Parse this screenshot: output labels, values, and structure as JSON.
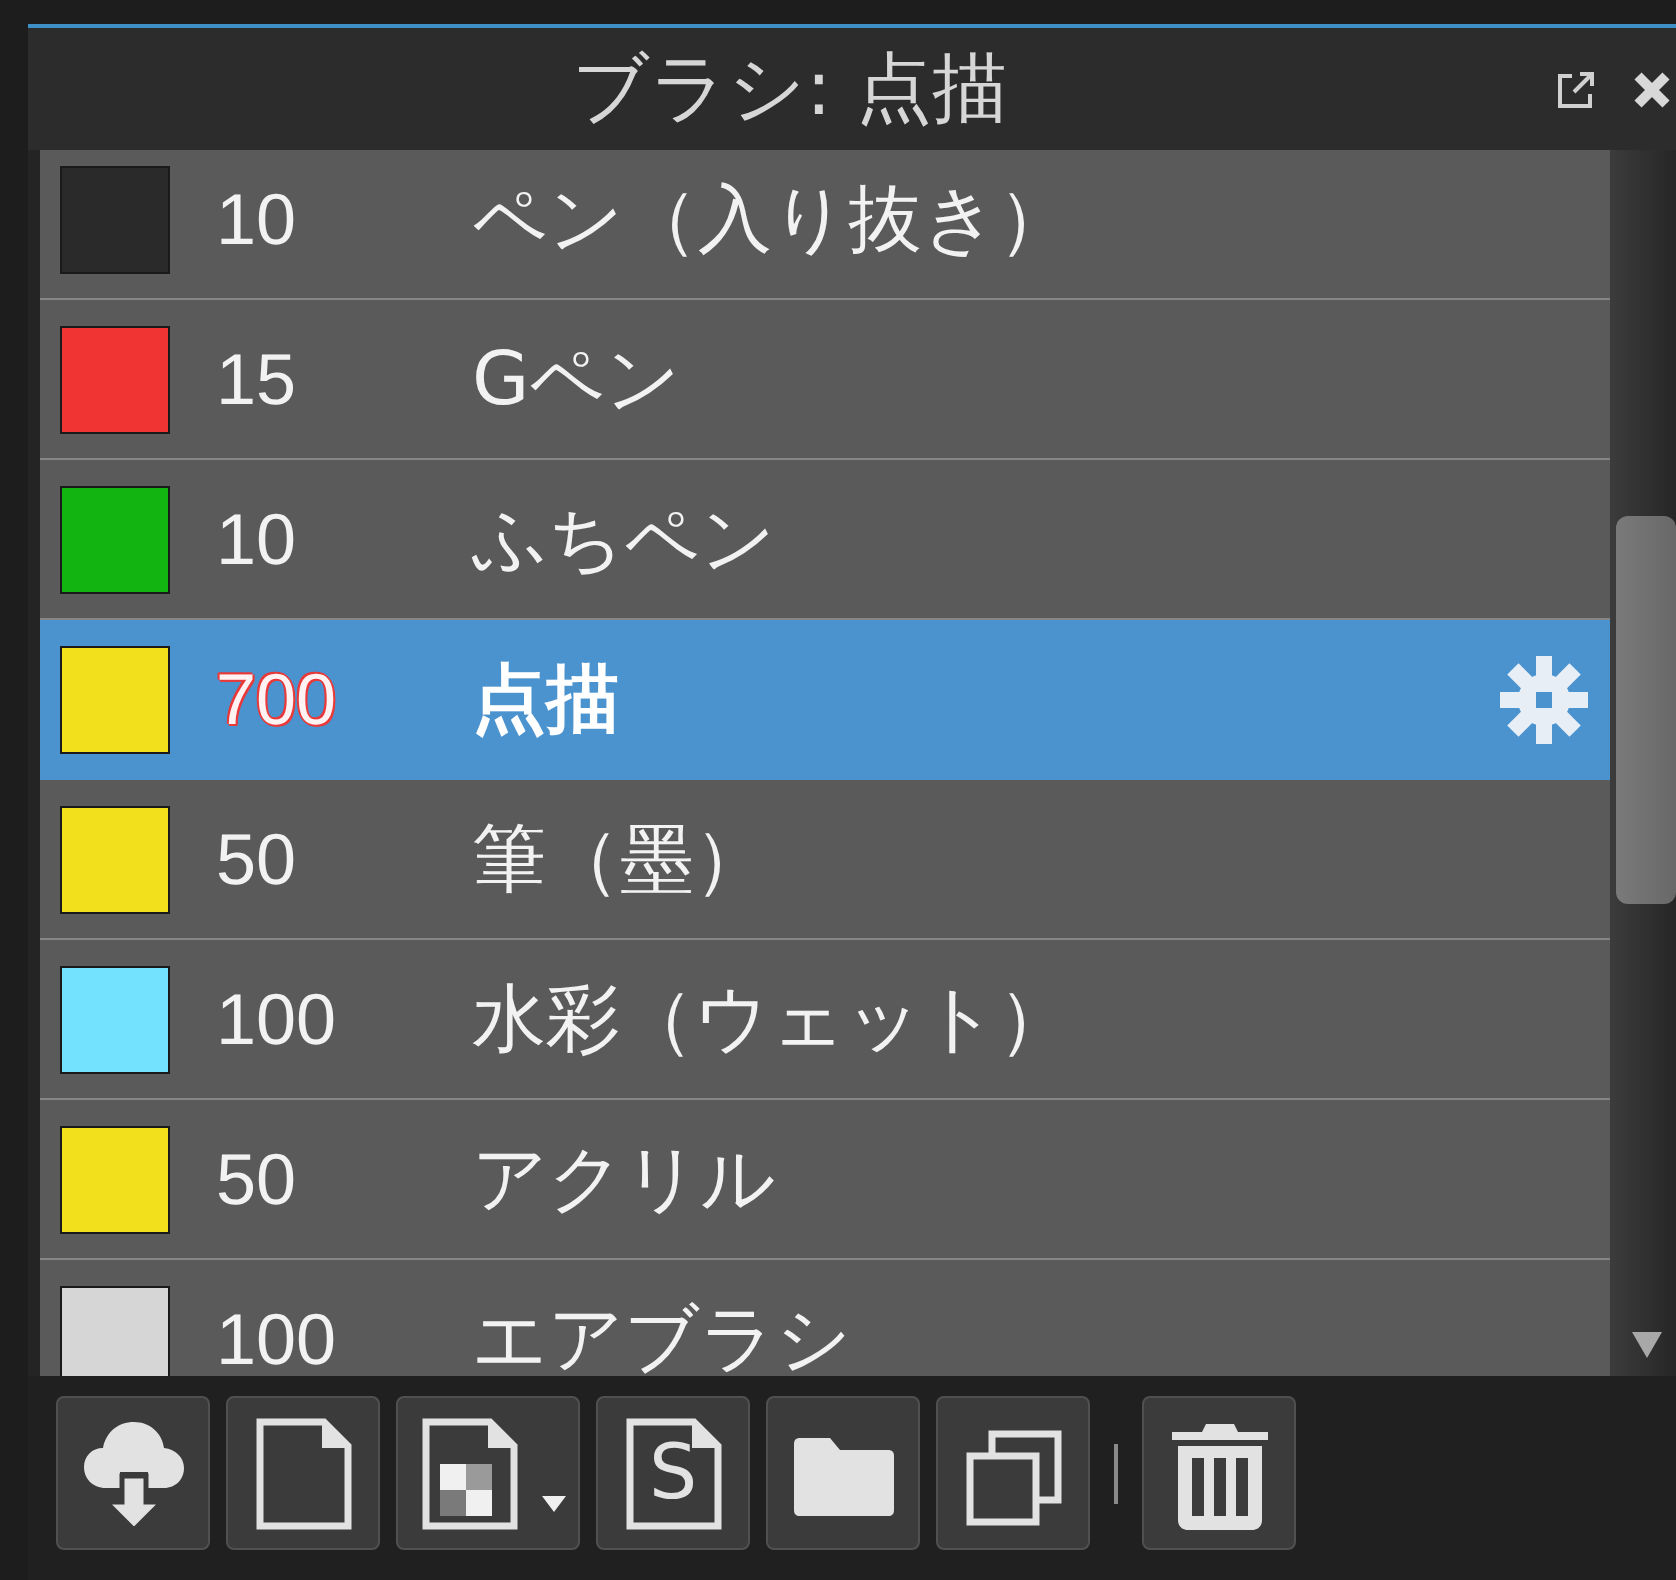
{
  "panel": {
    "title": "ブラシ: 点描"
  },
  "brushes": [
    {
      "color": "#2a2a2a",
      "size": "10",
      "name": "ペン（入り抜き）",
      "selected": false
    },
    {
      "color": "#f03434",
      "size": "15",
      "name": "Gペン",
      "selected": false
    },
    {
      "color": "#12b412",
      "size": "10",
      "name": "ふちペン",
      "selected": false
    },
    {
      "color": "#f2e01c",
      "size": "700",
      "name": "点描",
      "selected": true
    },
    {
      "color": "#f2e01c",
      "size": "50",
      "name": "筆（墨）",
      "selected": false
    },
    {
      "color": "#72e2ff",
      "size": "100",
      "name": "水彩（ウェット）",
      "selected": false
    },
    {
      "color": "#f2e01c",
      "size": "50",
      "name": "アクリル",
      "selected": false
    },
    {
      "color": "#d6d6d6",
      "size": "100",
      "name": "エアブラシ",
      "selected": false
    }
  ],
  "toolbar": {
    "script_file_letter": "S"
  }
}
